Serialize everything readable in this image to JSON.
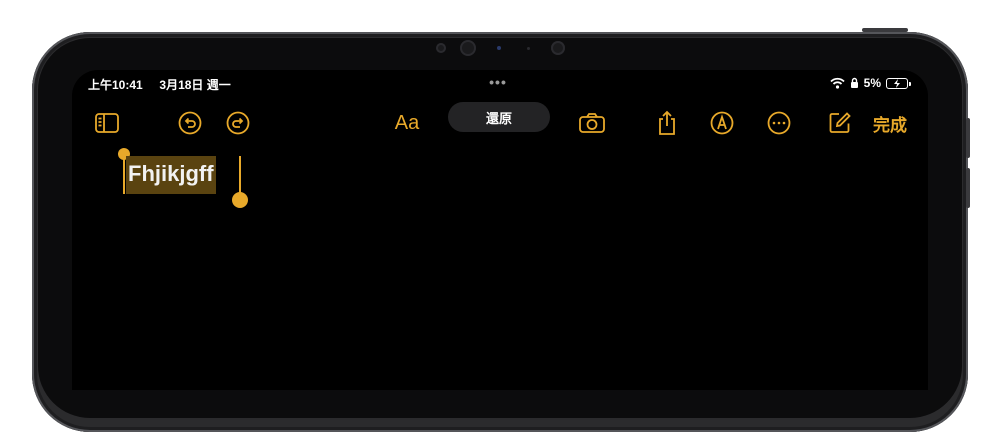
{
  "status_bar": {
    "time": "上午10:41",
    "date": "3月18日 週一",
    "battery_percent": "5%",
    "multitask_indicator": "•••"
  },
  "toolbar": {
    "format_label": "Aa",
    "done_label": "完成",
    "toast_label": "還原",
    "icons": [
      "sidebar-icon",
      "undo-icon",
      "redo-icon",
      "camera-icon",
      "share-icon",
      "markup-icon",
      "more-icon",
      "compose-icon"
    ],
    "accent_color": "#e8a92a"
  },
  "note": {
    "selected_text": "Fhjikjgff",
    "selection_color": "#5a4310"
  }
}
